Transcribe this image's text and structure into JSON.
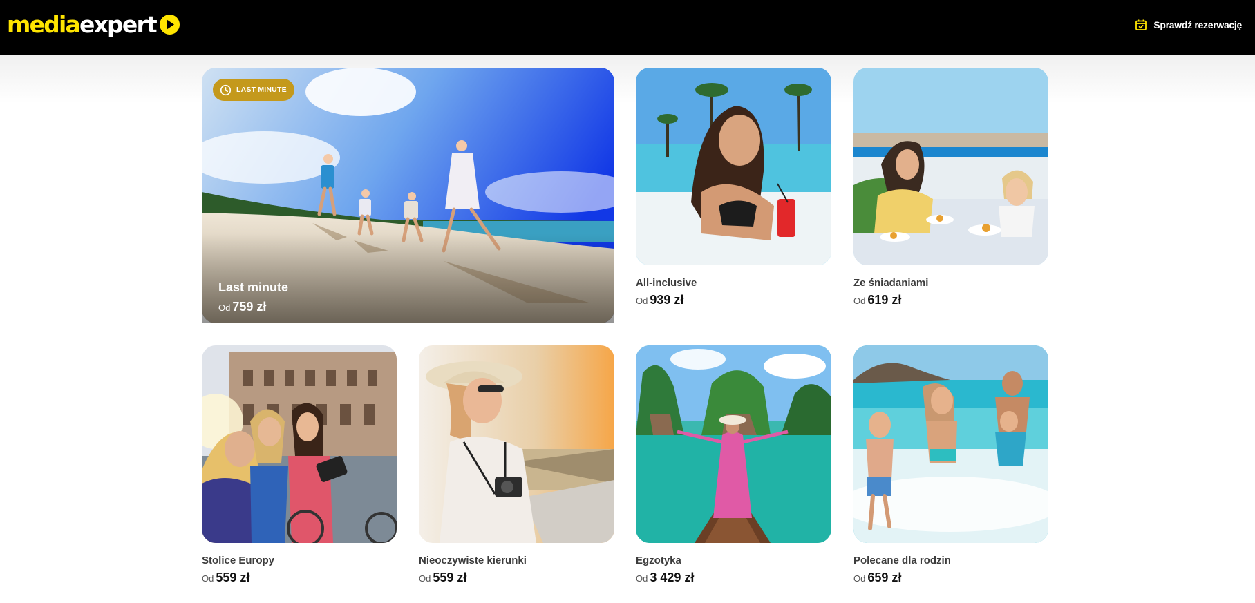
{
  "header": {
    "logo": {
      "part1": "media",
      "part2": "expert"
    },
    "reservation": {
      "icon": "calendar-check-icon",
      "label": "Sprawdź rezerwację"
    }
  },
  "colors": {
    "brand_yellow": "#ffe500",
    "header_bg": "#000000",
    "badge_gold": "#c4991c"
  },
  "featured": {
    "badge": {
      "icon": "clock-icon",
      "label": "LAST MINUTE"
    },
    "title": "Last minute",
    "price_prefix": "Od",
    "price": "759 zł"
  },
  "offers": [
    {
      "title": "All-inclusive",
      "price_prefix": "Od",
      "price": "939 zł"
    },
    {
      "title": "Ze śniadaniami",
      "price_prefix": "Od",
      "price": "619 zł"
    },
    {
      "title": "Stolice Europy",
      "price_prefix": "Od",
      "price": "559 zł"
    },
    {
      "title": "Nieoczywiste kierunki",
      "price_prefix": "Od",
      "price": "559 zł"
    },
    {
      "title": "Egzotyka",
      "price_prefix": "Od",
      "price": "3 429 zł"
    },
    {
      "title": "Polecane dla rodzin",
      "price_prefix": "Od",
      "price": "659 zł"
    }
  ]
}
